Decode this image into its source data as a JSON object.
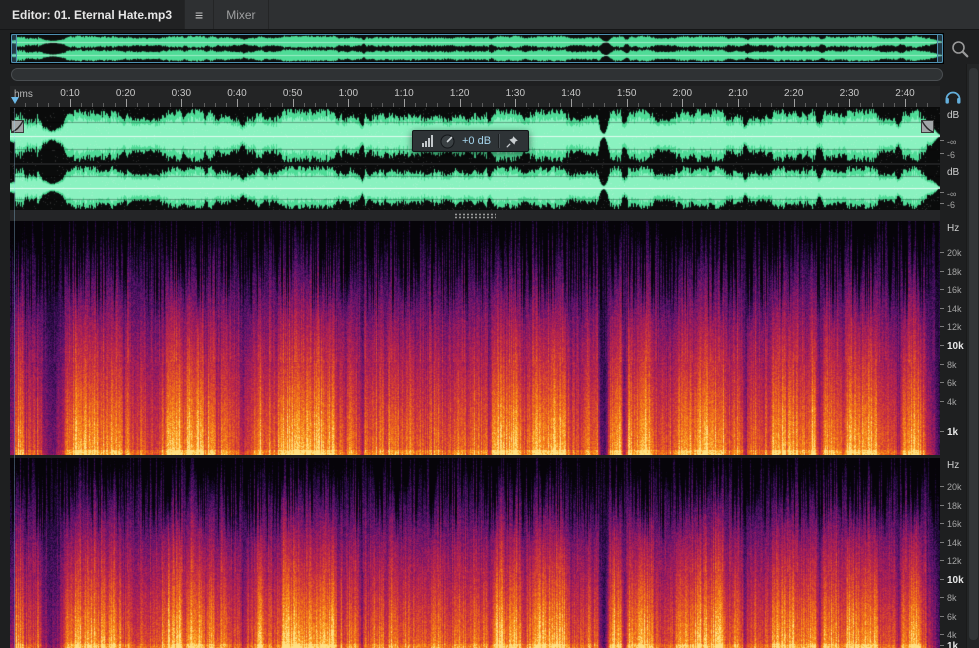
{
  "tabs": {
    "editor_label": "Editor: 01. Eternal Hate.mp3",
    "mixer_label": "Mixer"
  },
  "icons": {
    "panel_menu_glyph": "≡"
  },
  "ruler": {
    "format_label": "hms",
    "major_tick_labels": [
      "0:10",
      "0:20",
      "0:30",
      "0:40",
      "0:50",
      "1:00",
      "1:10",
      "1:20",
      "1:30",
      "1:40",
      "1:50",
      "2:00",
      "2:10",
      "2:20",
      "2:30",
      "2:40"
    ]
  },
  "hud": {
    "gain_value": "+0 dB"
  },
  "amplitude_scale": {
    "unit": "dB",
    "tick_labels": [
      "-∞",
      "-6"
    ]
  },
  "frequency_scale": {
    "unit": "Hz",
    "tick_labels": [
      "20k",
      "18k",
      "16k",
      "14k",
      "12k",
      "10k",
      "8k",
      "6k",
      "4k",
      "1k"
    ],
    "bold_labels": [
      "10k",
      "1k"
    ]
  },
  "colors": {
    "waveform_green": "#4fdc97",
    "waveform_green_light": "#8af2c0",
    "waveform_bg": "#0a0b0b",
    "accent_blue": "#57a8d4",
    "hud_value_text": "#a6d6ee",
    "spectrogram_colormap": [
      [
        0.0,
        "#060409"
      ],
      [
        0.15,
        "#210b3d"
      ],
      [
        0.3,
        "#5b136e"
      ],
      [
        0.45,
        "#9b1b5e"
      ],
      [
        0.58,
        "#c32b44"
      ],
      [
        0.7,
        "#e04f28"
      ],
      [
        0.82,
        "#f57d16"
      ],
      [
        0.92,
        "#fcae2e"
      ],
      [
        1.0,
        "#ffe082"
      ]
    ]
  }
}
